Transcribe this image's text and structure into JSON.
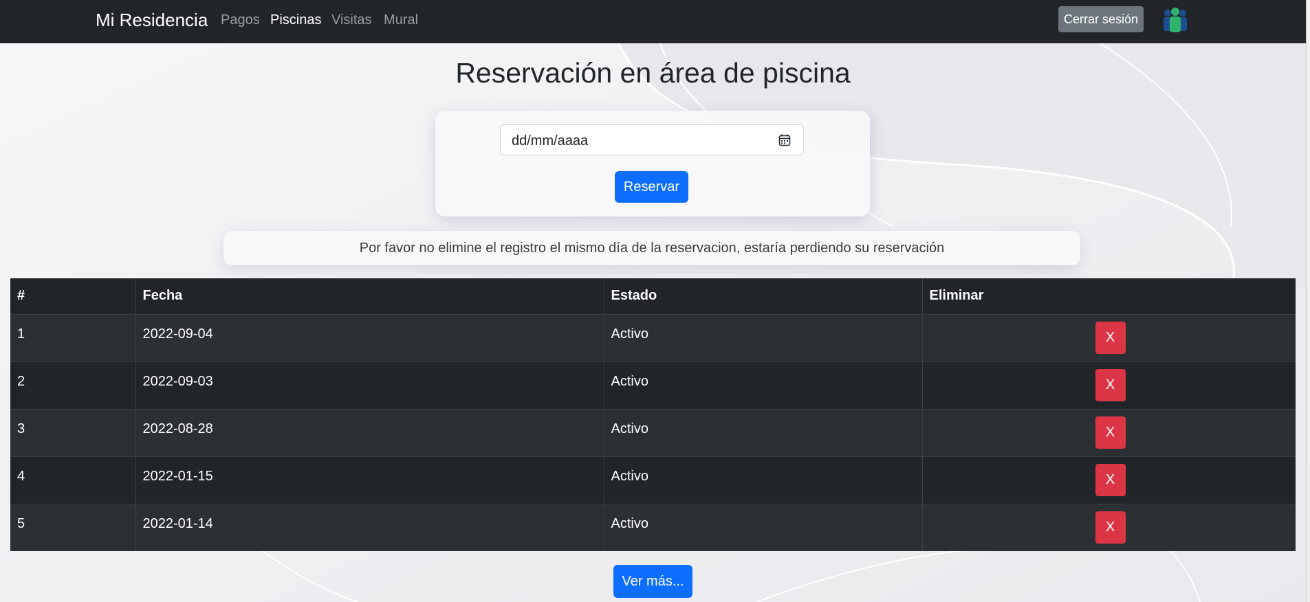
{
  "navbar": {
    "brand": "Mi Residencia",
    "links": [
      {
        "label": "Pagos",
        "active": false
      },
      {
        "label": "Piscinas",
        "active": true
      },
      {
        "label": "Visitas",
        "active": false
      },
      {
        "label": "Mural",
        "active": false
      }
    ],
    "logout_label": "Cerrar sesión",
    "avatar_icon": "users-avatar-icon"
  },
  "main": {
    "title": "Reservación en área de piscina",
    "date_input": {
      "placeholder": "dd/mm/aaaa",
      "icon": "calendar-icon"
    },
    "reserve_label": "Reservar",
    "notice": "Por favor no elimine el registro el mismo día de la reservacion, estaría perdiendo su reservación",
    "table": {
      "headers": [
        "#",
        "Fecha",
        "Estado",
        "Eliminar"
      ],
      "rows": [
        {
          "num": "1",
          "fecha": "2022-09-04",
          "estado": "Activo",
          "delete": "X"
        },
        {
          "num": "2",
          "fecha": "2022-09-03",
          "estado": "Activo",
          "delete": "X"
        },
        {
          "num": "3",
          "fecha": "2022-08-28",
          "estado": "Activo",
          "delete": "X"
        },
        {
          "num": "4",
          "fecha": "2022-01-15",
          "estado": "Activo",
          "delete": "X"
        },
        {
          "num": "5",
          "fecha": "2022-01-14",
          "estado": "Activo",
          "delete": "X"
        }
      ]
    },
    "more_label": "Ver más..."
  },
  "colors": {
    "navbar": "#212529",
    "primary": "#0d6efd",
    "danger": "#dc3545",
    "secondary": "#6c757d",
    "table_dark": "#212529",
    "table_stripe": "#2c3034"
  }
}
